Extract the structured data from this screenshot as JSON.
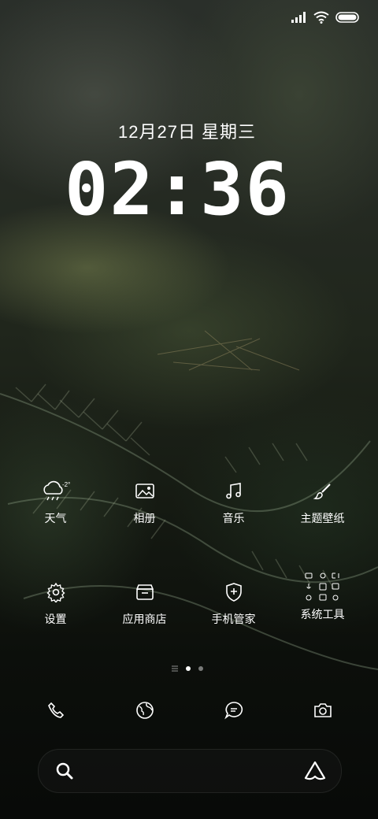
{
  "lockscreen": {
    "date": "12月27日 星期三",
    "time": "02:36"
  },
  "apps_row1": [
    {
      "label": "天气",
      "icon": "weather-rain-icon",
      "badge": "-2°"
    },
    {
      "label": "相册",
      "icon": "gallery-icon"
    },
    {
      "label": "音乐",
      "icon": "music-note-icon"
    },
    {
      "label": "主题壁纸",
      "icon": "paintbrush-icon"
    }
  ],
  "apps_row2": [
    {
      "label": "设置",
      "icon": "gear-icon"
    },
    {
      "label": "应用商店",
      "icon": "store-icon"
    },
    {
      "label": "手机管家",
      "icon": "shield-plus-icon"
    },
    {
      "label": "系统工具",
      "icon": "tools-folder-icon"
    }
  ],
  "dock": [
    "phone-icon",
    "browser-globe-icon",
    "messages-icon",
    "camera-icon"
  ],
  "search_bar": {
    "left_icon": "search-icon",
    "right_icon": "assistant-icon"
  },
  "colors": {
    "text": "#ffffff",
    "background": "#0d100d"
  }
}
